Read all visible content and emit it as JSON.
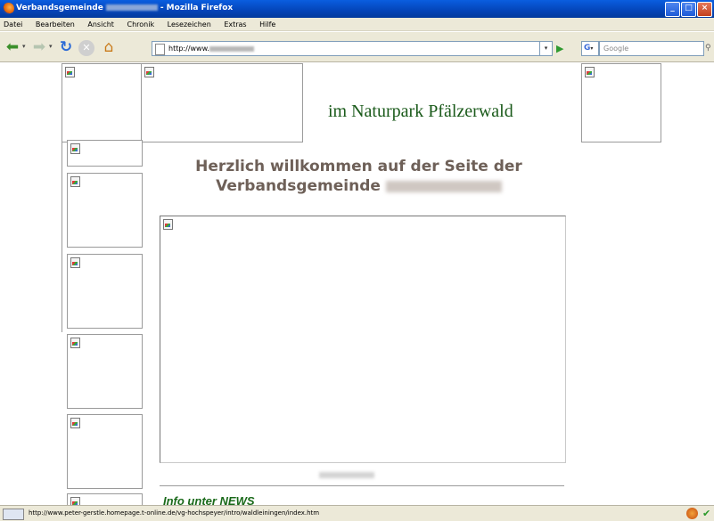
{
  "window": {
    "title_prefix": "Verbandsgemeinde",
    "title_suffix": "- Mozilla Firefox",
    "buttons": {
      "minimize": "_",
      "maximize": "□",
      "close": "×"
    }
  },
  "menu": [
    "Datei",
    "Bearbeiten",
    "Ansicht",
    "Chronik",
    "Lesezeichen",
    "Extras",
    "Hilfe"
  ],
  "navbar": {
    "back_icon": "back-arrow-icon",
    "forward_icon": "forward-arrow-icon",
    "reload_icon": "reload-icon",
    "stop_icon": "stop-icon",
    "home_icon": "home-icon",
    "url_prefix": "http://www.",
    "search_engine": "G",
    "search_placeholder": "Google"
  },
  "page": {
    "headline": "im Naturpark Pfälzerwald",
    "welcome_line1": "Herzlich willkommen auf der Seite der",
    "welcome_line2": "Verbandsgemeinde",
    "news_link": "Info unter NEWS"
  },
  "status": {
    "url": "http://www.peter-gerstle.homepage.t-online.de/vg-hochspeyer/intro/waldleiningen/index.htm"
  },
  "colors": {
    "headline": "#1a5a1a",
    "welcome": "#6e6058",
    "news": "#1a6a1a",
    "titlebar": "#0a5ee0",
    "chrome": "#ece9d8"
  }
}
